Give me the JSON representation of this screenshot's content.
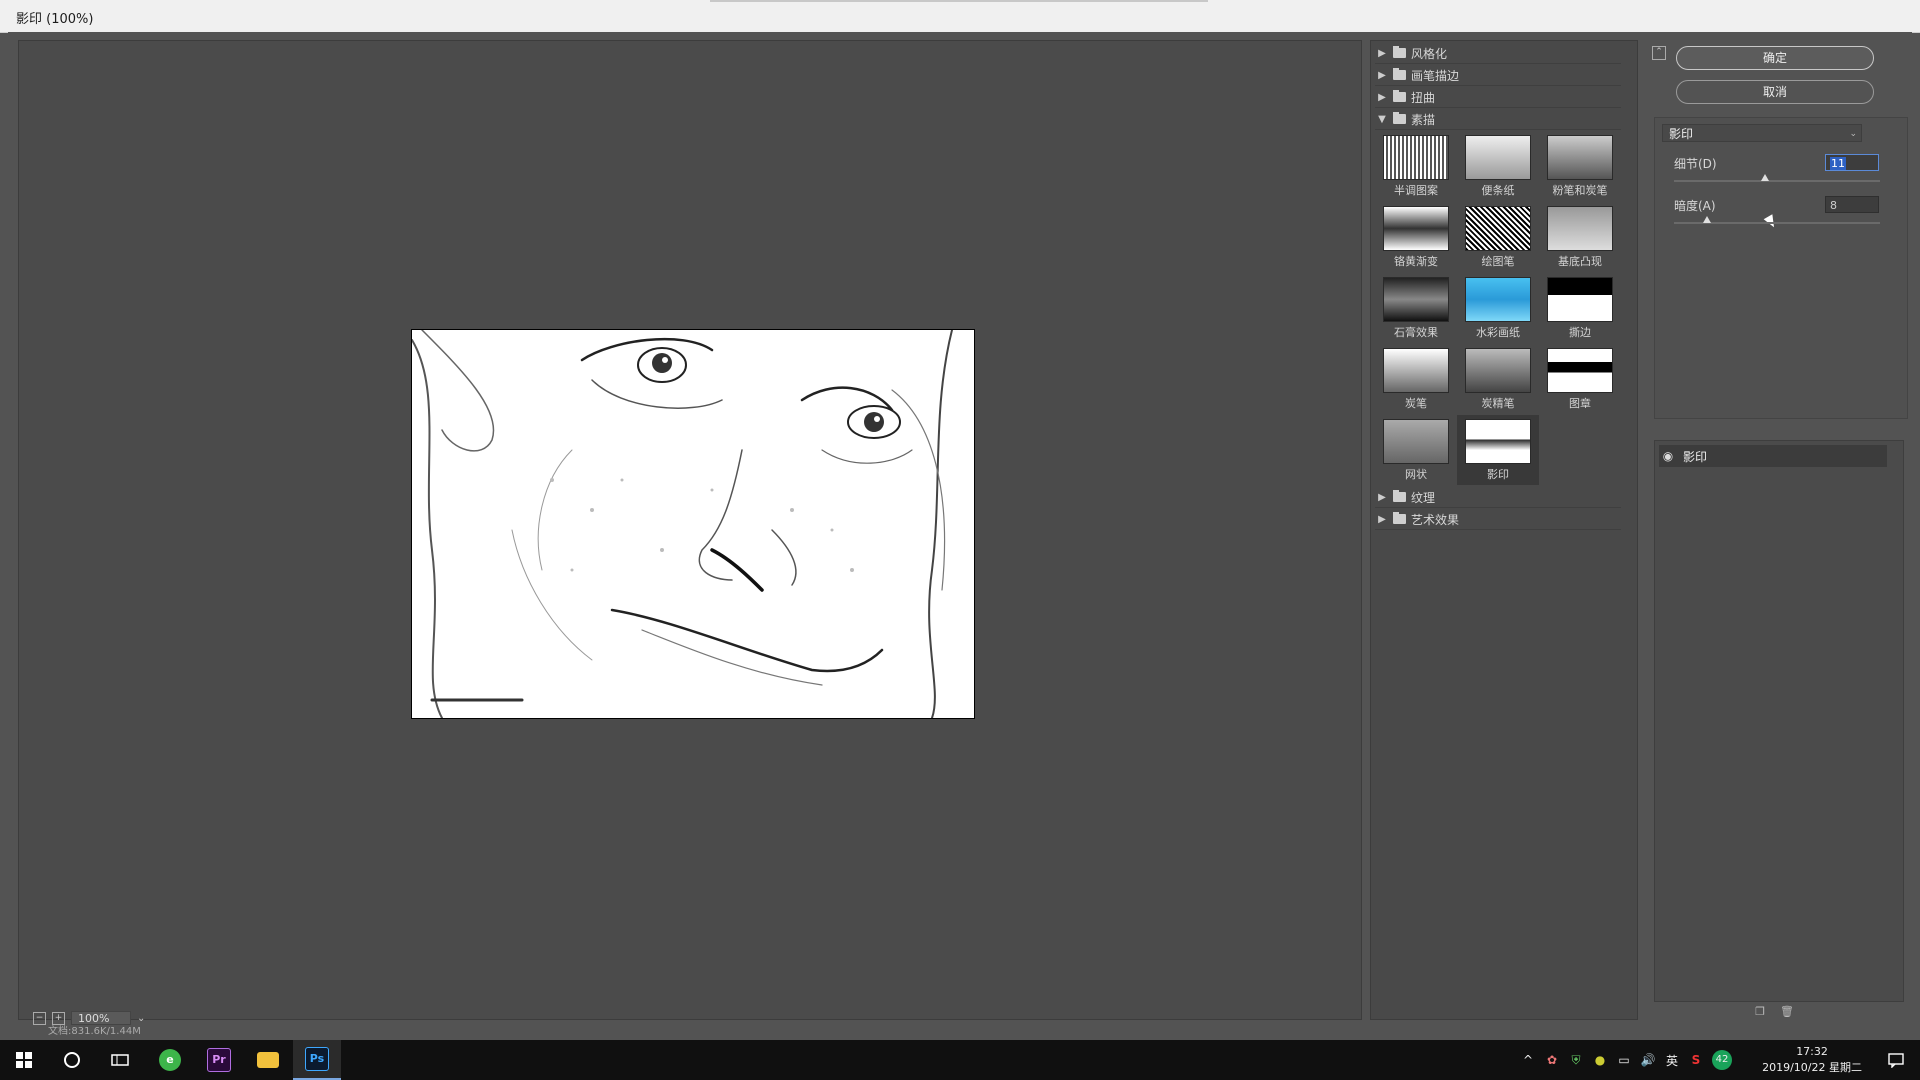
{
  "window": {
    "title": "影印 (100%)"
  },
  "canvas": {
    "zoom": "100%",
    "doc_status": "文档:831.6K/1.44M"
  },
  "gallery": {
    "categories_top": [
      {
        "label": "风格化",
        "expanded": false
      },
      {
        "label": "画笔描边",
        "expanded": false
      },
      {
        "label": "扭曲",
        "expanded": false
      },
      {
        "label": "素描",
        "expanded": true
      }
    ],
    "sketch_filters": [
      "半调图案",
      "便条纸",
      "粉笔和炭笔",
      "铬黄渐变",
      "绘图笔",
      "基底凸现",
      "石膏效果",
      "水彩画纸",
      "撕边",
      "炭笔",
      "炭精笔",
      "图章",
      "网状",
      "影印"
    ],
    "selected_filter": "影印",
    "categories_bottom": [
      {
        "label": "纹理",
        "expanded": false
      },
      {
        "label": "艺术效果",
        "expanded": false
      }
    ]
  },
  "settings": {
    "ok_label": "确定",
    "cancel_label": "取消",
    "filter_select": "影印",
    "detail_label": "细节(D)",
    "detail_value": "11",
    "detail_fraction": 0.44,
    "darkness_label": "暗度(A)",
    "darkness_value": "8",
    "darkness_fraction": 0.16,
    "layer_name": "影印"
  },
  "taskbar": {
    "apps": [
      "windows-start",
      "cortana",
      "task-view",
      "browser",
      "premiere",
      "file-explorer",
      "photoshop"
    ],
    "tray_ime": "英",
    "tray_badge": "42",
    "time": "17:32",
    "date": "2019/10/22 星期二"
  }
}
